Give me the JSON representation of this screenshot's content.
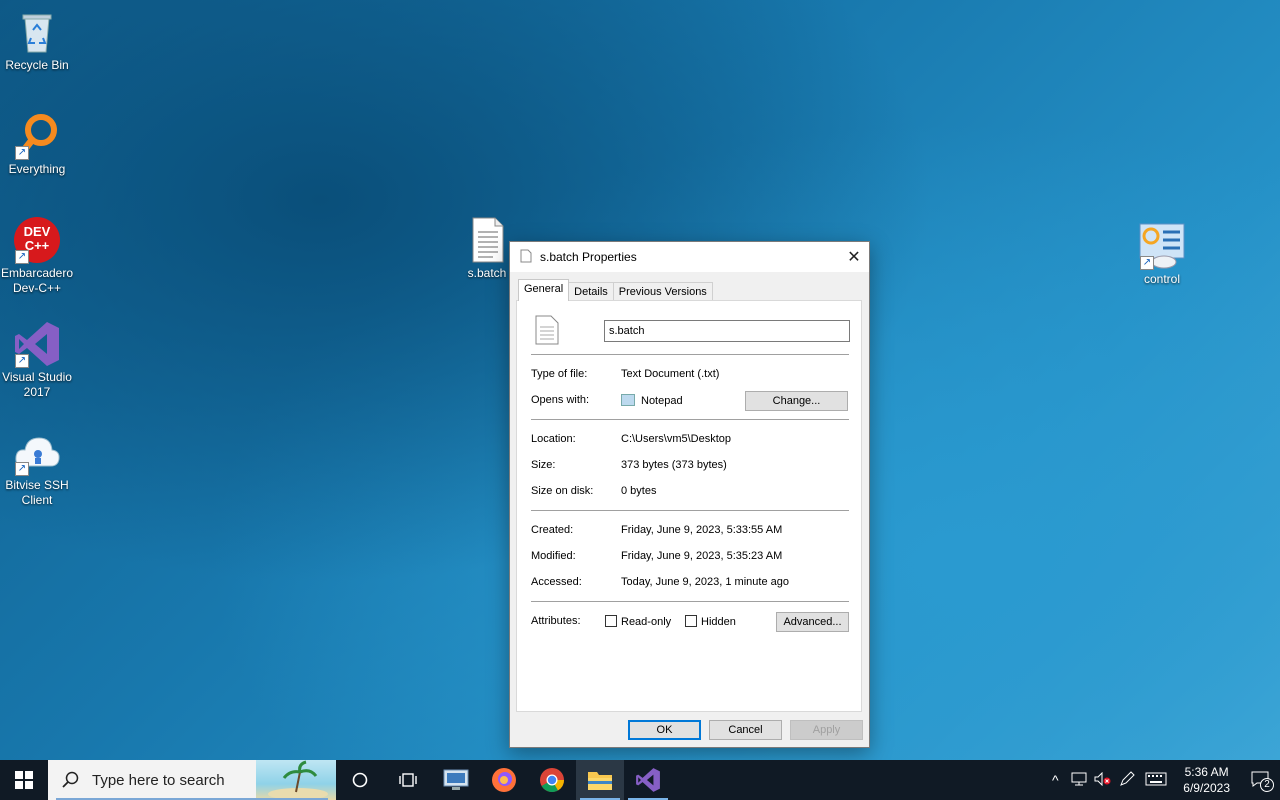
{
  "desktop": {
    "icons": [
      {
        "label": "Recycle Bin"
      },
      {
        "label": "Everything"
      },
      {
        "label": "Embarcadero Dev-C++",
        "logo_text": "DEV C++"
      },
      {
        "label": "Visual Studio 2017"
      },
      {
        "label": "Bitvise SSH Client"
      },
      {
        "label": "s.batch"
      },
      {
        "label": "control"
      }
    ]
  },
  "dialog": {
    "title": "s.batch Properties",
    "tabs": [
      "General",
      "Details",
      "Previous Versions"
    ],
    "filename": "s.batch",
    "type_label": "Type of file:",
    "type_value": "Text Document (.txt)",
    "opens_label": "Opens with:",
    "opens_value": "Notepad",
    "change_button": "Change...",
    "location_label": "Location:",
    "location_value": "C:\\Users\\vm5\\Desktop",
    "size_label": "Size:",
    "size_value": "373 bytes (373 bytes)",
    "size_disk_label": "Size on disk:",
    "size_disk_value": "0 bytes",
    "created_label": "Created:",
    "created_value": "Friday, June 9, 2023, 5:33:55 AM",
    "modified_label": "Modified:",
    "modified_value": "Friday, June 9, 2023, 5:35:23 AM",
    "accessed_label": "Accessed:",
    "accessed_value": "Today, June 9, 2023, 1 minute ago",
    "attributes_label": "Attributes:",
    "readonly_label": "Read-only",
    "hidden_label": "Hidden",
    "advanced_button": "Advanced...",
    "ok_button": "OK",
    "cancel_button": "Cancel",
    "apply_button": "Apply"
  },
  "taskbar": {
    "search_placeholder": "Type here to search",
    "time": "5:36 AM",
    "date": "6/9/2023",
    "notification_count": "2"
  },
  "colors": {
    "accent": "#0078d7",
    "taskbar": "#101a25"
  }
}
